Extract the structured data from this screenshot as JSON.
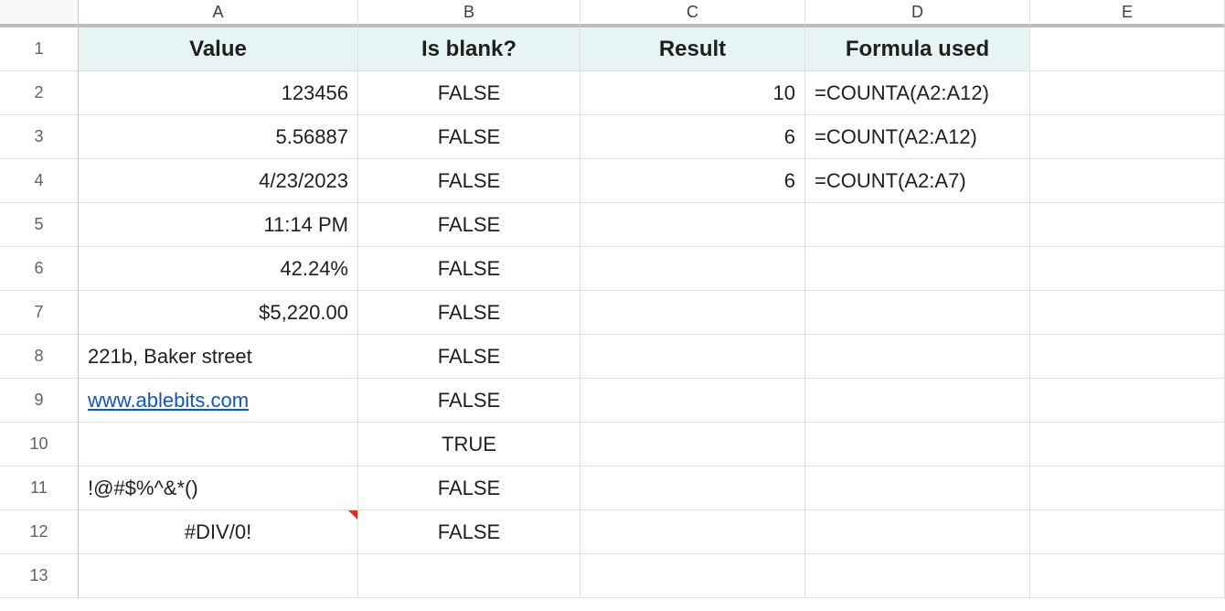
{
  "columns": [
    "A",
    "B",
    "C",
    "D",
    "E"
  ],
  "row_count": 13,
  "headers": {
    "A": "Value",
    "B": "Is blank?",
    "C": "Result",
    "D": "Formula used"
  },
  "rows": [
    {
      "A": "123456",
      "A_align": "right",
      "B": "FALSE",
      "C": "10",
      "D": "=COUNTA(A2:A12)"
    },
    {
      "A": "5.56887",
      "A_align": "right",
      "B": "FALSE",
      "C": "6",
      "D": "=COUNT(A2:A12)"
    },
    {
      "A": "4/23/2023",
      "A_align": "right",
      "B": "FALSE",
      "C": "6",
      "D": "=COUNT(A2:A7)"
    },
    {
      "A": "11:14 PM",
      "A_align": "right",
      "B": "FALSE",
      "C": "",
      "D": ""
    },
    {
      "A": "42.24%",
      "A_align": "right",
      "B": "FALSE",
      "C": "",
      "D": ""
    },
    {
      "A": "$5,220.00",
      "A_align": "right",
      "B": "FALSE",
      "C": "",
      "D": ""
    },
    {
      "A": "221b, Baker street",
      "A_align": "left",
      "B": "FALSE",
      "C": "",
      "D": ""
    },
    {
      "A": "www.ablebits.com",
      "A_align": "left",
      "A_link": true,
      "B": "FALSE",
      "C": "",
      "D": ""
    },
    {
      "A": "",
      "A_align": "left",
      "B": "TRUE",
      "C": "",
      "D": ""
    },
    {
      "A": "!@#$%^&*()",
      "A_align": "left",
      "B": "FALSE",
      "C": "",
      "D": ""
    },
    {
      "A": "#DIV/0!",
      "A_align": "center",
      "A_note": true,
      "B": "FALSE",
      "C": "",
      "D": ""
    }
  ]
}
